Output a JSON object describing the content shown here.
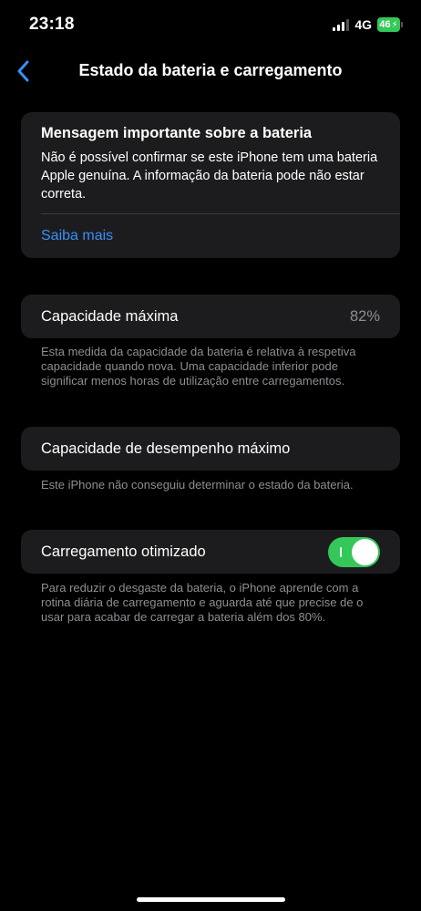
{
  "status_bar": {
    "time": "23:18",
    "network": "4G",
    "battery_level": "46",
    "battery_color": "#34c759"
  },
  "nav": {
    "back_icon": "chevron-left-icon",
    "title": "Estado da bateria e carregamento"
  },
  "message": {
    "title": "Mensagem importante sobre a bateria",
    "body": "Não é possível confirmar se este iPhone tem uma bateria Apple genuína. A informação da bateria pode não estar correta.",
    "link": "Saiba mais",
    "link_color": "#3a8ff5"
  },
  "max_capacity": {
    "label": "Capacidade máxima",
    "value": "82%",
    "footnote": "Esta medida da capacidade da bateria é relativa à respetiva capacidade quando nova. Uma capacidade inferior pode significar menos horas de utilização entre carregamentos."
  },
  "peak_performance": {
    "label": "Capacidade de desempenho máximo",
    "footnote": "Este iPhone não conseguiu determinar o estado da bateria."
  },
  "optimized_charging": {
    "label": "Carregamento otimizado",
    "enabled": true,
    "toggle_color": "#34c759",
    "footnote": "Para reduzir o desgaste da bateria, o iPhone aprende com a rotina diária de carregamento e aguarda até que precise de o usar para acabar de carregar a bateria além dos 80%."
  }
}
